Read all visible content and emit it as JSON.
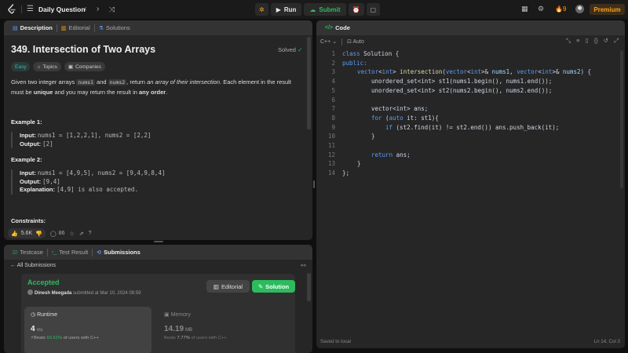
{
  "topbar": {
    "title": "Daily Question",
    "run_label": "Run",
    "submit_label": "Submit",
    "streak": "9",
    "premium_label": "Premium"
  },
  "description_panel": {
    "tabs": [
      {
        "label": "Description",
        "icon": "document-icon",
        "active": true
      },
      {
        "label": "Editorial",
        "icon": "book-icon",
        "active": false
      },
      {
        "label": "Solutions",
        "icon": "flask-icon",
        "active": false
      }
    ],
    "title": "349. Intersection of Two Arrays",
    "solved_label": "Solved",
    "chips": {
      "difficulty": "Easy",
      "topics": "Topics",
      "companies": "Companies"
    },
    "para": {
      "p1": "Given two integer arrays ",
      "c1": "nums1",
      "p2": " and ",
      "c2": "nums2",
      "p3": ", return ",
      "em": "an array of their intersection",
      "p4": ". Each element in the result must be ",
      "b1": "unique",
      "p5": " and you may return the result in ",
      "b2": "any order",
      "p6": "."
    },
    "examples": [
      {
        "heading": "Example 1:",
        "input_label": "Input:",
        "input": "nums1 = [1,2,2,1], nums2 = [2,2]",
        "output_label": "Output:",
        "output": "[2]"
      },
      {
        "heading": "Example 2:",
        "input_label": "Input:",
        "input": "nums1 = [4,9,5], nums2 = [9,4,9,8,4]",
        "output_label": "Output:",
        "output": "[9,4]",
        "explanation_label": "Explanation:",
        "explanation": "[4,9] is also accepted."
      }
    ],
    "constraints_heading": "Constraints:",
    "likes": "5.6K",
    "comments": "86"
  },
  "submissions_panel": {
    "tabs": [
      {
        "label": "Testcase",
        "active": false
      },
      {
        "label": "Test Result",
        "active": false
      },
      {
        "label": "Submissions",
        "active": true
      }
    ],
    "back_label": "All Submissions",
    "status": "Accepted",
    "author": "Dinesh Meegada",
    "submitted_text": "submitted at Mar 10, 2024 08:59",
    "editorial_label": "Editorial",
    "solution_label": "Solution",
    "runtime": {
      "label": "Runtime",
      "value": "4",
      "unit": "ms",
      "beats_prefix": "Beats",
      "beats_pct": "60.61%",
      "beats_suffix": "of users with C++"
    },
    "memory": {
      "label": "Memory",
      "value": "14.19",
      "unit": "MB",
      "beats_prefix": "Beats",
      "beats_pct": "7.77%",
      "beats_suffix": "of users with C++"
    }
  },
  "code_panel": {
    "tab_label": "Code",
    "language": "C++",
    "auto_label": "Auto",
    "lines": [
      {
        "n": "1"
      },
      {
        "n": "2"
      },
      {
        "n": "3"
      },
      {
        "n": "4"
      },
      {
        "n": "5"
      },
      {
        "n": "6"
      },
      {
        "n": "7"
      },
      {
        "n": "8"
      },
      {
        "n": "9"
      },
      {
        "n": "10"
      },
      {
        "n": "11"
      },
      {
        "n": "12"
      },
      {
        "n": "13"
      },
      {
        "n": "14"
      }
    ],
    "code": {
      "l1a": "class",
      "l1b": " Solution {",
      "l2": "public:",
      "l3a": "vector",
      "l3b": "<",
      "l3c": "int",
      "l3d": "> ",
      "l3e": "intersection",
      "l3f": "(",
      "l3g": "vector",
      "l3h": "<",
      "l3i": "int",
      "l3j": ">& ",
      "l3k": "nums1",
      "l3l": ", ",
      "l3m": "vector",
      "l3n": "<",
      "l3o": "int",
      "l3p": ">& ",
      "l3q": "nums2",
      "l3r": ") {",
      "l4": "unordered_set<int> st1(nums1.begin(), nums1.end());",
      "l5": "unordered_set<int> st2(nums2.begin(), nums2.end());",
      "l7": "vector<int> ans;",
      "l8a": "for",
      "l8b": " (",
      "l8c": "auto",
      "l8d": " it: st1){",
      "l9a": "if",
      "l9b": " (st2.find(it) != st2.end()) ans.push_back(it);",
      "l10": "}",
      "l12a": "return",
      "l12b": " ans;",
      "l13": "}",
      "l14": "};"
    },
    "footer_left": "Saved to local",
    "footer_right": "Ln 14, Col 3"
  },
  "colors": {
    "accent_green": "#2cbb5d",
    "accent_orange": "#ffa116",
    "easy": "#22c3b8"
  }
}
